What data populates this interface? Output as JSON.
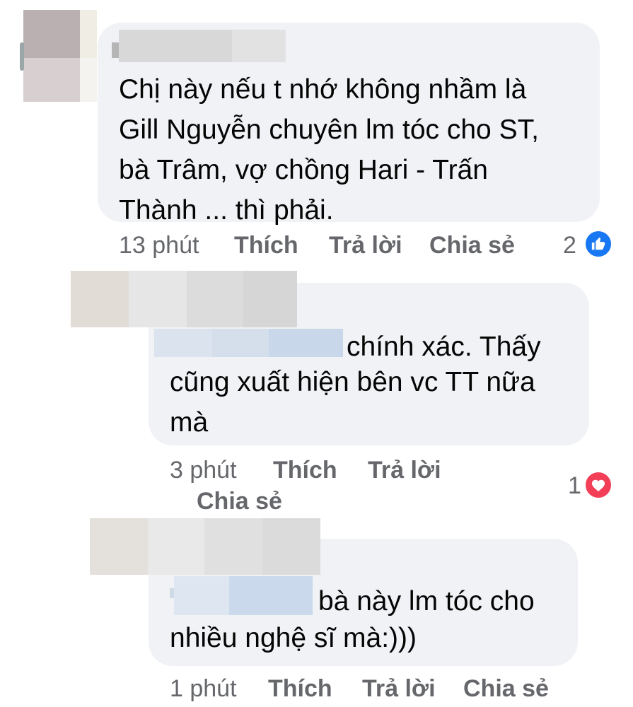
{
  "comments": [
    {
      "text": "Chị này nếu t nhớ không nhầm là\nGill Nguyễn chuyên lm tóc cho ST,\nbà Trâm, vợ chồng Hari - Trấn\nThành ... thì phải.",
      "time": "13 phút",
      "like_label": "Thích",
      "reply_label": "Trả lời",
      "share_label": "Chia sẻ",
      "reaction_count": "2",
      "reaction_icon": "like-icon",
      "reaction_color": "#1877f2"
    },
    {
      "text_line1": "chính xác. Thấy",
      "text_rest": "cũng xuất hiện bên vc TT nữa\nmà",
      "time": "3 phút",
      "like_label": "Thích",
      "reply_label": "Trả lời",
      "share_label": "Chia sẻ",
      "reaction_count": "1",
      "reaction_icon": "heart-icon",
      "reaction_color": "#f33e58"
    },
    {
      "text_line1": "bà này lm tóc cho",
      "text_rest": "nhiều nghệ sĩ mà:)))",
      "time": "1 phút",
      "like_label": "Thích",
      "reply_label": "Trả lời",
      "share_label": "Chia sẻ"
    }
  ]
}
